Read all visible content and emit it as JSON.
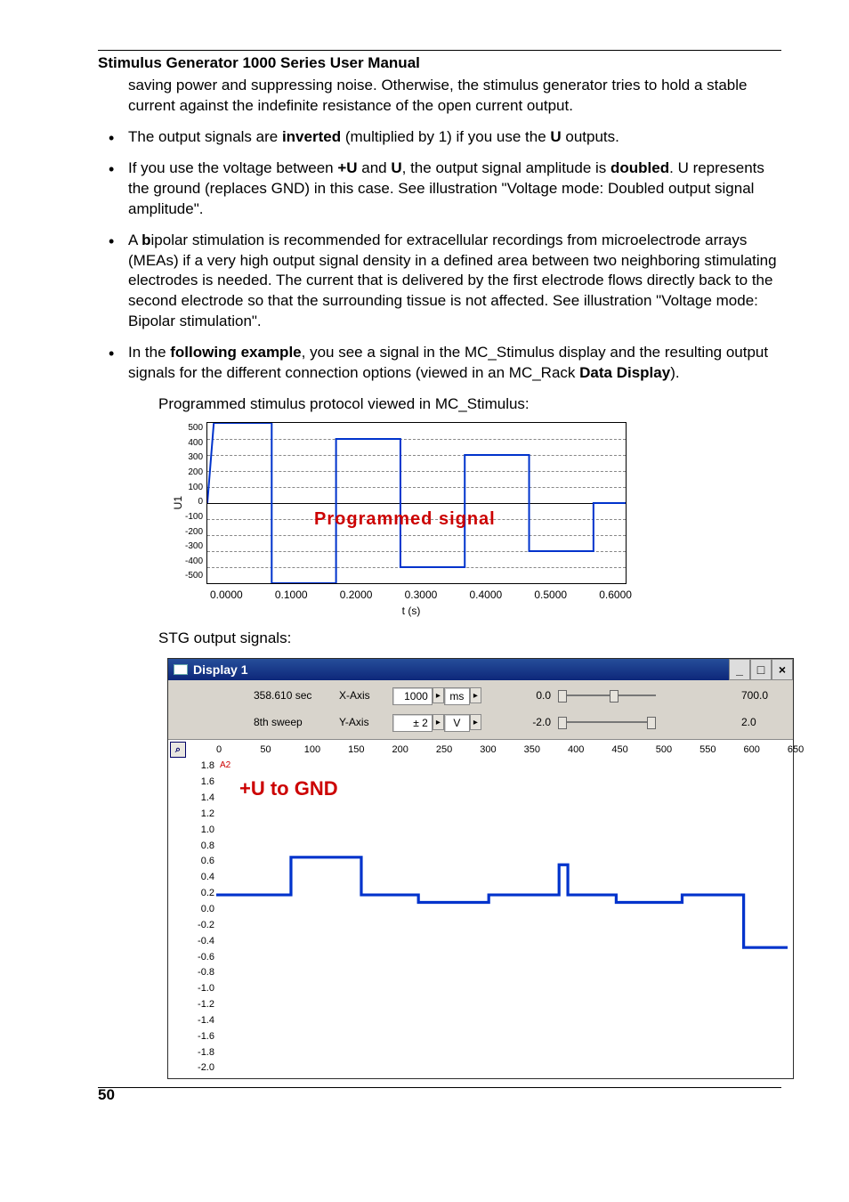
{
  "header": {
    "title": "Stimulus Generator 1000 Series User Manual"
  },
  "intro_continuation": "saving power and suppressing noise. Otherwise, the stimulus generator tries to hold a stable current against the indefinite resistance of the open current output.",
  "bullets": [
    {
      "pre": "The output signals are ",
      "b1": "inverted",
      "mid1": " (multiplied by 1) if you use the ",
      "b2": "U",
      "post": " outputs."
    },
    {
      "pre": "If you use the voltage between ",
      "b1": "+U",
      "mid1": " and ",
      "b2": "U",
      "mid2": ", the output signal amplitude is ",
      "b3": "doubled",
      "post": ". U represents the ground (replaces GND) in this case. See illustration \"Voltage mode: Doubled output signal amplitude\"."
    },
    {
      "pre": "A ",
      "b1": "b",
      "mid1": "ipolar stimulation is recommended for extracellular recordings from microelectrode arrays (MEAs) if a very high output signal density in a defined area between two neighboring stimulating electrodes is needed. The current that is delivered by the first electrode flows directly back to the second electrode so that the surrounding tissue is not affected. See illustration \"Voltage mode: Bipolar stimulation\"."
    },
    {
      "pre": "In the ",
      "b1": "following example",
      "mid1": ", you see a signal in the MC_Stimulus display and the resulting output signals for the different connection options (viewed in an MC_Rack ",
      "b2": "Data Display",
      "post": ")."
    }
  ],
  "caption1": "Programmed stimulus protocol viewed in MC_Stimulus:",
  "caption2": "STG output signals:",
  "display1": {
    "title": "Display 1",
    "win_btns": {
      "min": "_",
      "max": "□",
      "close": "×"
    },
    "row1": {
      "time": "358.610 sec",
      "axis_label": "X-Axis",
      "spin_val": "1000",
      "spin_unit": "ms",
      "range_lo": "0.0",
      "range_hi": "700.0"
    },
    "row2": {
      "sweep": "8th sweep",
      "axis_label": "Y-Axis",
      "spin_val": "± 2",
      "spin_unit": "V",
      "range_lo": "-2.0",
      "range_hi": "2.0"
    },
    "plot": {
      "x_ticks": [
        "0",
        "50",
        "100",
        "150",
        "200",
        "250",
        "300",
        "350",
        "400",
        "450",
        "500",
        "550",
        "600",
        "650"
      ],
      "series_name": "A2",
      "y_ticks": [
        "1.8",
        "1.6",
        "1.4",
        "1.2",
        "1.0",
        "0.8",
        "0.6",
        "0.4",
        "0.2",
        "0.0",
        "-0.2",
        "-0.4",
        "-0.6",
        "-0.8",
        "-1.0",
        "-1.2",
        "-1.4",
        "-1.6",
        "-1.8",
        "-2.0"
      ],
      "annotation": "+U to GND"
    }
  },
  "chart_data": [
    {
      "type": "line",
      "title": "Programmed signal",
      "xlabel": "t (s)",
      "ylabel": "U1",
      "xlim": [
        0.0,
        0.65
      ],
      "ylim": [
        -500,
        500
      ],
      "x_ticks": [
        "0.0000",
        "0.1000",
        "0.2000",
        "0.3000",
        "0.4000",
        "0.5000",
        "0.6000"
      ],
      "y_ticks": [
        500,
        400,
        300,
        200,
        100,
        0,
        -100,
        -200,
        -300,
        -400,
        -500
      ],
      "series": [
        {
          "name": "Programmed signal",
          "color": "#0033cc",
          "x": [
            0.0,
            0.01,
            0.1,
            0.1,
            0.2,
            0.2,
            0.3,
            0.3,
            0.4,
            0.4,
            0.5,
            0.5,
            0.6,
            0.6,
            0.65
          ],
          "y": [
            0,
            500,
            500,
            -500,
            -500,
            400,
            400,
            -400,
            -400,
            300,
            300,
            -300,
            -300,
            0,
            0
          ]
        }
      ]
    },
    {
      "type": "line",
      "title": "+U to GND",
      "xlabel": "ms",
      "ylabel": "V",
      "xlim": [
        0,
        650
      ],
      "ylim": [
        -2.0,
        1.8
      ],
      "x_ticks": [
        0,
        50,
        100,
        150,
        200,
        250,
        300,
        350,
        400,
        450,
        500,
        550,
        600,
        650
      ],
      "y_ticks": [
        1.8,
        1.6,
        1.4,
        1.2,
        1.0,
        0.8,
        0.6,
        0.4,
        0.2,
        0.0,
        -0.2,
        -0.4,
        -0.6,
        -0.8,
        -1.0,
        -1.2,
        -1.4,
        -1.6,
        -1.8,
        -2.0
      ],
      "series": [
        {
          "name": "A2",
          "color": "#0033cc",
          "x": [
            0,
            85,
            85,
            165,
            165,
            230,
            230,
            310,
            310,
            390,
            390,
            400,
            400,
            455,
            455,
            530,
            530,
            600,
            600,
            650
          ],
          "y": [
            0.0,
            0.0,
            0.5,
            0.5,
            0.0,
            0.0,
            -0.1,
            -0.1,
            0.0,
            0.0,
            0.4,
            0.4,
            0.0,
            0.0,
            -0.1,
            -0.1,
            0.0,
            0.0,
            -0.7,
            -0.7
          ]
        }
      ]
    }
  ],
  "page_number": "50"
}
